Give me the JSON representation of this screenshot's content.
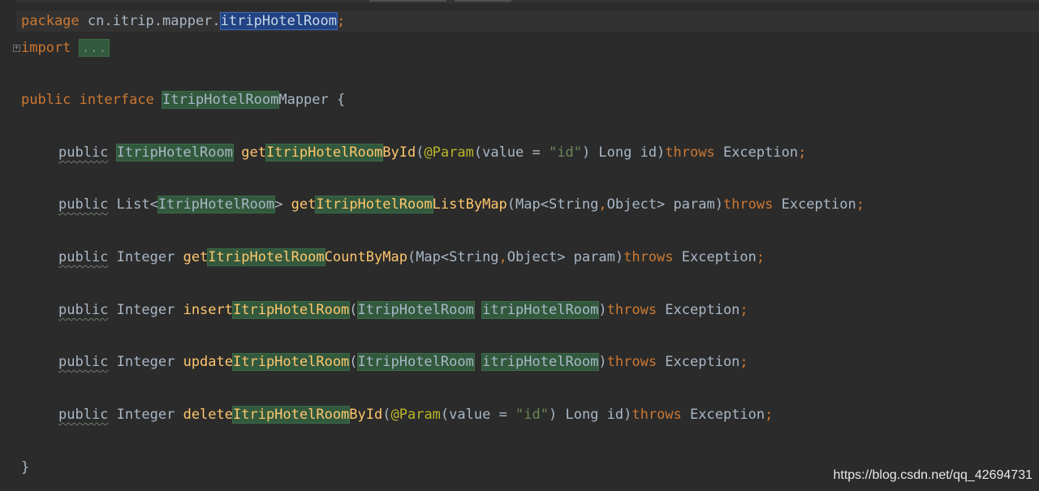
{
  "editor": {
    "line_package": {
      "keyword": "package",
      "pkg": " cn.itrip.mapper.",
      "selected": "itripHotelRoom",
      "semicolon": ";"
    },
    "line_import": {
      "keyword": "import",
      "folded": "..."
    },
    "line_interface": {
      "mod": "public",
      "kw": "interface",
      "type_hl": "ItripHotelRoom",
      "type_rest": "Mapper",
      "brace": " {"
    },
    "methods": [
      {
        "pub": "public",
        "ret_hl": "ItripHotelRoom",
        "name_pre": "get",
        "name_hl": "ItripHotelRoom",
        "name_post": "ById",
        "p_open": "(",
        "ann": "@Param",
        "ann_args_a": "(value = ",
        "ann_str": "\"id\"",
        "ann_args_b": ") Long id)",
        "throws": "throws",
        "exc": " Exception",
        "semi": ";"
      },
      {
        "pub": "public",
        "ret_pre": "List<",
        "ret_hl": "ItripHotelRoom",
        "ret_post": ">",
        "name_pre": "get",
        "name_hl": "ItripHotelRoom",
        "name_post": "ListByMap",
        "args_a": "(Map<String",
        "comma": ",",
        "args_b": "Object> param)",
        "throws": "throws",
        "exc": " Exception",
        "semi": ";"
      },
      {
        "pub": "public",
        "ret": "Integer",
        "name_pre": "get",
        "name_hl": "ItripHotelRoom",
        "name_post": "CountByMap",
        "args_a": "(Map<String",
        "comma": ",",
        "args_b": "Object> param)",
        "throws": "throws",
        "exc": " Exception",
        "semi": ";"
      },
      {
        "pub": "public",
        "ret": "Integer",
        "name_pre": "insert",
        "name_hl": "ItripHotelRoom",
        "p_open": "(",
        "type_hl": "ItripHotelRoom",
        "var_hl": "itripHotelRoom",
        "p_close": ")",
        "throws": "throws",
        "exc": " Exception",
        "semi": ";"
      },
      {
        "pub": "public",
        "ret": "Integer",
        "name_pre": "update",
        "name_hl": "ItripHotelRoom",
        "p_open": "(",
        "type_hl": "ItripHotelRoom",
        "var_hl": "itripHotelRoom",
        "p_close": ")",
        "throws": "throws",
        "exc": " Exception",
        "semi": ";"
      },
      {
        "pub": "public",
        "ret": "Integer",
        "name_pre": "delete",
        "name_hl": "ItripHotelRoom",
        "name_post": "ById",
        "p_open": "(",
        "ann": "@Param",
        "ann_args_a": "(value = ",
        "ann_str": "\"id\"",
        "ann_args_b": ") Long id)",
        "throws": "throws",
        "exc": " Exception",
        "semi": ";"
      }
    ],
    "closing_brace": "}"
  },
  "watermark": "https://blog.csdn.net/qq_42694731",
  "colors": {
    "background": "#2b2b2b",
    "keyword": "#cc7832",
    "method": "#ffc66d",
    "string": "#6a8759",
    "annotation": "#bbb529",
    "text": "#a9b7c6",
    "highlight": "#32593d",
    "selection": "#214283"
  }
}
